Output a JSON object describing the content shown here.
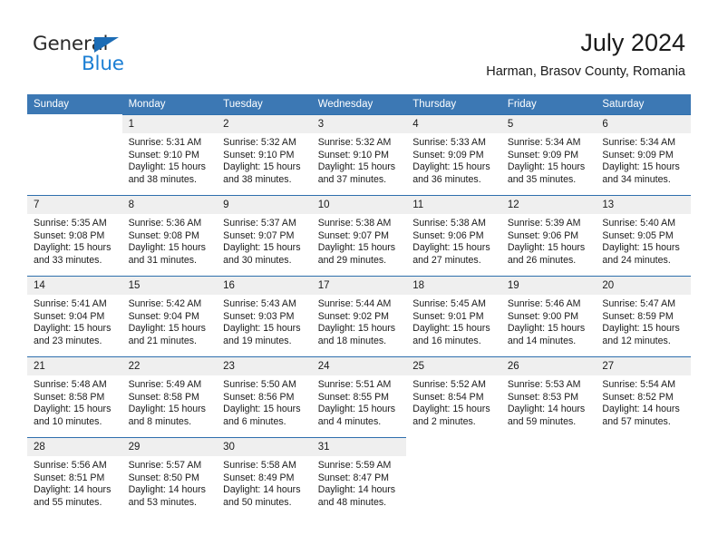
{
  "logo": {
    "text_general": "General",
    "text_blue": "Blue",
    "color_blue": "#1c7fd4",
    "color_triangle": "#1c6cb5"
  },
  "header": {
    "title": "July 2024",
    "subtitle": "Harman, Brasov County, Romania"
  },
  "theme": {
    "header_bg": "#3c78b4",
    "header_text": "#ffffff",
    "daynum_bg": "#efefef",
    "row_rule": "#2f6fad"
  },
  "weekday_headers": [
    "Sunday",
    "Monday",
    "Tuesday",
    "Wednesday",
    "Thursday",
    "Friday",
    "Saturday"
  ],
  "labels": {
    "sunrise_prefix": "Sunrise:",
    "sunset_prefix": "Sunset:",
    "daylight_prefix": "Daylight:"
  },
  "weeks": [
    [
      {
        "day": "",
        "sunrise": "",
        "sunset": "",
        "daylight_line1": "",
        "daylight_line2": ""
      },
      {
        "day": "1",
        "sunrise": "Sunrise: 5:31 AM",
        "sunset": "Sunset: 9:10 PM",
        "daylight_line1": "Daylight: 15 hours",
        "daylight_line2": "and 38 minutes."
      },
      {
        "day": "2",
        "sunrise": "Sunrise: 5:32 AM",
        "sunset": "Sunset: 9:10 PM",
        "daylight_line1": "Daylight: 15 hours",
        "daylight_line2": "and 38 minutes."
      },
      {
        "day": "3",
        "sunrise": "Sunrise: 5:32 AM",
        "sunset": "Sunset: 9:10 PM",
        "daylight_line1": "Daylight: 15 hours",
        "daylight_line2": "and 37 minutes."
      },
      {
        "day": "4",
        "sunrise": "Sunrise: 5:33 AM",
        "sunset": "Sunset: 9:09 PM",
        "daylight_line1": "Daylight: 15 hours",
        "daylight_line2": "and 36 minutes."
      },
      {
        "day": "5",
        "sunrise": "Sunrise: 5:34 AM",
        "sunset": "Sunset: 9:09 PM",
        "daylight_line1": "Daylight: 15 hours",
        "daylight_line2": "and 35 minutes."
      },
      {
        "day": "6",
        "sunrise": "Sunrise: 5:34 AM",
        "sunset": "Sunset: 9:09 PM",
        "daylight_line1": "Daylight: 15 hours",
        "daylight_line2": "and 34 minutes."
      }
    ],
    [
      {
        "day": "7",
        "sunrise": "Sunrise: 5:35 AM",
        "sunset": "Sunset: 9:08 PM",
        "daylight_line1": "Daylight: 15 hours",
        "daylight_line2": "and 33 minutes."
      },
      {
        "day": "8",
        "sunrise": "Sunrise: 5:36 AM",
        "sunset": "Sunset: 9:08 PM",
        "daylight_line1": "Daylight: 15 hours",
        "daylight_line2": "and 31 minutes."
      },
      {
        "day": "9",
        "sunrise": "Sunrise: 5:37 AM",
        "sunset": "Sunset: 9:07 PM",
        "daylight_line1": "Daylight: 15 hours",
        "daylight_line2": "and 30 minutes."
      },
      {
        "day": "10",
        "sunrise": "Sunrise: 5:38 AM",
        "sunset": "Sunset: 9:07 PM",
        "daylight_line1": "Daylight: 15 hours",
        "daylight_line2": "and 29 minutes."
      },
      {
        "day": "11",
        "sunrise": "Sunrise: 5:38 AM",
        "sunset": "Sunset: 9:06 PM",
        "daylight_line1": "Daylight: 15 hours",
        "daylight_line2": "and 27 minutes."
      },
      {
        "day": "12",
        "sunrise": "Sunrise: 5:39 AM",
        "sunset": "Sunset: 9:06 PM",
        "daylight_line1": "Daylight: 15 hours",
        "daylight_line2": "and 26 minutes."
      },
      {
        "day": "13",
        "sunrise": "Sunrise: 5:40 AM",
        "sunset": "Sunset: 9:05 PM",
        "daylight_line1": "Daylight: 15 hours",
        "daylight_line2": "and 24 minutes."
      }
    ],
    [
      {
        "day": "14",
        "sunrise": "Sunrise: 5:41 AM",
        "sunset": "Sunset: 9:04 PM",
        "daylight_line1": "Daylight: 15 hours",
        "daylight_line2": "and 23 minutes."
      },
      {
        "day": "15",
        "sunrise": "Sunrise: 5:42 AM",
        "sunset": "Sunset: 9:04 PM",
        "daylight_line1": "Daylight: 15 hours",
        "daylight_line2": "and 21 minutes."
      },
      {
        "day": "16",
        "sunrise": "Sunrise: 5:43 AM",
        "sunset": "Sunset: 9:03 PM",
        "daylight_line1": "Daylight: 15 hours",
        "daylight_line2": "and 19 minutes."
      },
      {
        "day": "17",
        "sunrise": "Sunrise: 5:44 AM",
        "sunset": "Sunset: 9:02 PM",
        "daylight_line1": "Daylight: 15 hours",
        "daylight_line2": "and 18 minutes."
      },
      {
        "day": "18",
        "sunrise": "Sunrise: 5:45 AM",
        "sunset": "Sunset: 9:01 PM",
        "daylight_line1": "Daylight: 15 hours",
        "daylight_line2": "and 16 minutes."
      },
      {
        "day": "19",
        "sunrise": "Sunrise: 5:46 AM",
        "sunset": "Sunset: 9:00 PM",
        "daylight_line1": "Daylight: 15 hours",
        "daylight_line2": "and 14 minutes."
      },
      {
        "day": "20",
        "sunrise": "Sunrise: 5:47 AM",
        "sunset": "Sunset: 8:59 PM",
        "daylight_line1": "Daylight: 15 hours",
        "daylight_line2": "and 12 minutes."
      }
    ],
    [
      {
        "day": "21",
        "sunrise": "Sunrise: 5:48 AM",
        "sunset": "Sunset: 8:58 PM",
        "daylight_line1": "Daylight: 15 hours",
        "daylight_line2": "and 10 minutes."
      },
      {
        "day": "22",
        "sunrise": "Sunrise: 5:49 AM",
        "sunset": "Sunset: 8:58 PM",
        "daylight_line1": "Daylight: 15 hours",
        "daylight_line2": "and 8 minutes."
      },
      {
        "day": "23",
        "sunrise": "Sunrise: 5:50 AM",
        "sunset": "Sunset: 8:56 PM",
        "daylight_line1": "Daylight: 15 hours",
        "daylight_line2": "and 6 minutes."
      },
      {
        "day": "24",
        "sunrise": "Sunrise: 5:51 AM",
        "sunset": "Sunset: 8:55 PM",
        "daylight_line1": "Daylight: 15 hours",
        "daylight_line2": "and 4 minutes."
      },
      {
        "day": "25",
        "sunrise": "Sunrise: 5:52 AM",
        "sunset": "Sunset: 8:54 PM",
        "daylight_line1": "Daylight: 15 hours",
        "daylight_line2": "and 2 minutes."
      },
      {
        "day": "26",
        "sunrise": "Sunrise: 5:53 AM",
        "sunset": "Sunset: 8:53 PM",
        "daylight_line1": "Daylight: 14 hours",
        "daylight_line2": "and 59 minutes."
      },
      {
        "day": "27",
        "sunrise": "Sunrise: 5:54 AM",
        "sunset": "Sunset: 8:52 PM",
        "daylight_line1": "Daylight: 14 hours",
        "daylight_line2": "and 57 minutes."
      }
    ],
    [
      {
        "day": "28",
        "sunrise": "Sunrise: 5:56 AM",
        "sunset": "Sunset: 8:51 PM",
        "daylight_line1": "Daylight: 14 hours",
        "daylight_line2": "and 55 minutes."
      },
      {
        "day": "29",
        "sunrise": "Sunrise: 5:57 AM",
        "sunset": "Sunset: 8:50 PM",
        "daylight_line1": "Daylight: 14 hours",
        "daylight_line2": "and 53 minutes."
      },
      {
        "day": "30",
        "sunrise": "Sunrise: 5:58 AM",
        "sunset": "Sunset: 8:49 PM",
        "daylight_line1": "Daylight: 14 hours",
        "daylight_line2": "and 50 minutes."
      },
      {
        "day": "31",
        "sunrise": "Sunrise: 5:59 AM",
        "sunset": "Sunset: 8:47 PM",
        "daylight_line1": "Daylight: 14 hours",
        "daylight_line2": "and 48 minutes."
      },
      {
        "day": "",
        "sunrise": "",
        "sunset": "",
        "daylight_line1": "",
        "daylight_line2": ""
      },
      {
        "day": "",
        "sunrise": "",
        "sunset": "",
        "daylight_line1": "",
        "daylight_line2": ""
      },
      {
        "day": "",
        "sunrise": "",
        "sunset": "",
        "daylight_line1": "",
        "daylight_line2": ""
      }
    ]
  ]
}
